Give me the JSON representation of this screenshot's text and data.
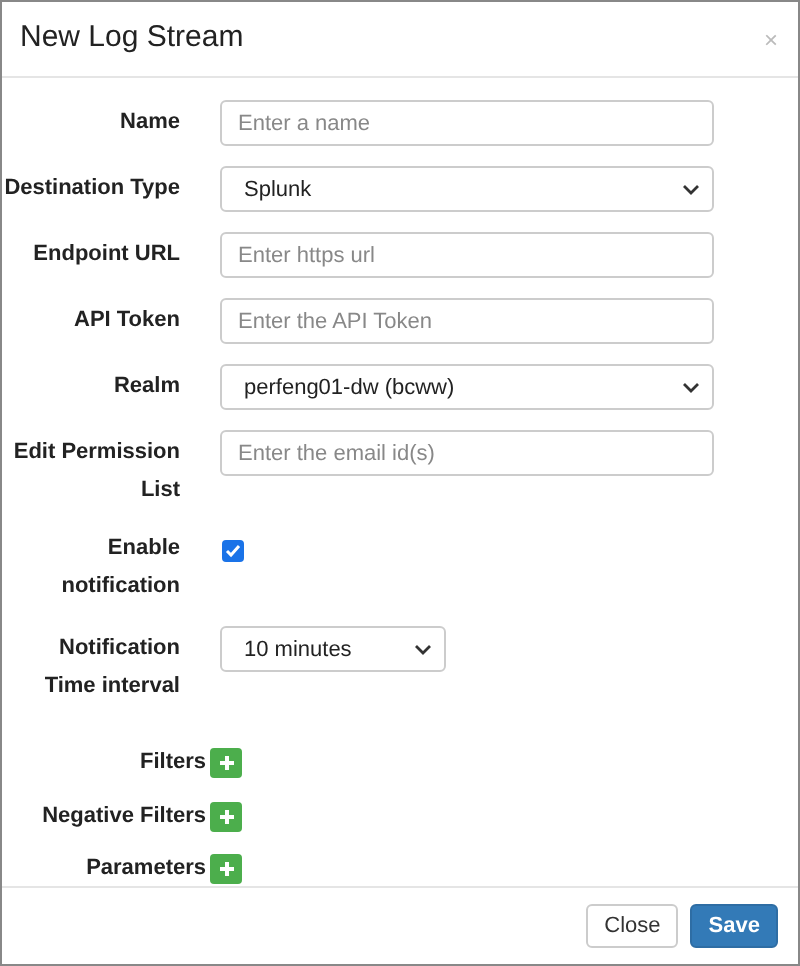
{
  "dialog": {
    "title": "New Log Stream",
    "close": "×"
  },
  "fields": [
    {
      "kind": "text",
      "label": "Name",
      "placeholder": "Enter a name"
    },
    {
      "kind": "select",
      "label": "Destination Type",
      "value": "Splunk"
    },
    {
      "kind": "text",
      "label": "Endpoint URL",
      "placeholder": "Enter https url"
    },
    {
      "kind": "text",
      "label": "API Token",
      "placeholder": "Enter the API Token"
    },
    {
      "kind": "select",
      "label": "Realm",
      "value": "perfeng01-dw (bcww)"
    },
    {
      "kind": "text",
      "label": "Edit Permission List",
      "placeholder": "Enter the email id(s)"
    },
    {
      "kind": "checkbox",
      "label": "Enable notification",
      "checked": true
    },
    {
      "kind": "select-small",
      "label": "Notification Time interval",
      "value": "10 minutes"
    }
  ],
  "add_rows": [
    {
      "label": "Filters"
    },
    {
      "label": "Negative Filters"
    },
    {
      "label": "Parameters"
    }
  ],
  "buttons": [
    {
      "label": "Close",
      "kind": "default"
    },
    {
      "label": "Save",
      "kind": "primary"
    }
  ]
}
